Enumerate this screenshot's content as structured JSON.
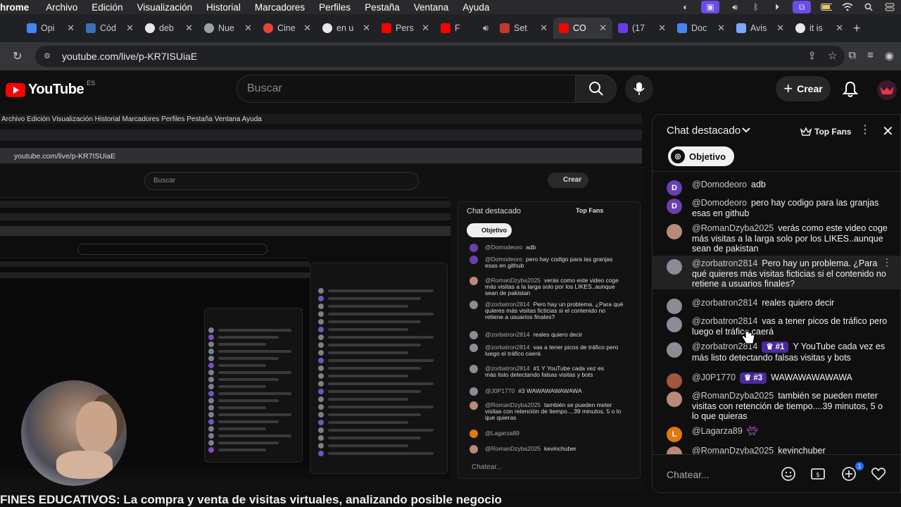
{
  "menubar": {
    "app": "hrome",
    "items": [
      "Archivo",
      "Edición",
      "Visualización",
      "Historial",
      "Marcadores",
      "Perfiles",
      "Pestaña",
      "Ventana",
      "Ayuda"
    ]
  },
  "tabs": [
    {
      "label": "Opi",
      "color": "#4285f4"
    },
    {
      "label": "Cód",
      "color": "#3b6fb6"
    },
    {
      "label": "deb",
      "color": "#e8e8e8"
    },
    {
      "label": "Nue",
      "color": "#9aa0a6"
    },
    {
      "label": "Cine",
      "color": "#ea4335"
    },
    {
      "label": "en u",
      "color": "#e8e8e8"
    },
    {
      "label": "Pers",
      "color": "#ff0000"
    },
    {
      "label": "F",
      "color": "#ff0000"
    },
    {
      "label": "Set",
      "color": "#c0392b"
    },
    {
      "label": "CO",
      "color": "#ff0000",
      "active": true
    },
    {
      "label": "(17",
      "color": "#6a3de8"
    },
    {
      "label": "Doc",
      "color": "#4285f4"
    },
    {
      "label": "Avis",
      "color": "#7aa7ff"
    },
    {
      "label": "it is",
      "color": "#e8e8e8"
    }
  ],
  "omnibox": {
    "url": "youtube.com/live/p-KR7ISUiaE"
  },
  "yt": {
    "logo": "YouTube",
    "country": "ES",
    "search_placeholder": "Buscar",
    "create_label": "Crear"
  },
  "nested": {
    "menu": "Archivo   Edición   Visualización   Historial   Marcadores   Perfiles   Pestaña   Ventana   Ayuda",
    "url": "youtube.com/live/p-KR7ISUiaE",
    "search": "Buscar",
    "create": "Crear",
    "chat_title": "Chat destacado",
    "top_fans": "Top Fans",
    "goal": "Objetivo",
    "chat_placeholder": "Chatear...",
    "lines": [
      {
        "author": "@Domodeoro",
        "text": "adb"
      },
      {
        "author": "@Domodeoro",
        "text": "pero hay codigo para las granjas"
      },
      {
        "author": "",
        "text": "esas en github"
      },
      {
        "author": "@RomanDzyba2025",
        "text": "verás como este video coge"
      },
      {
        "author": "",
        "text": "más visitas a la larga solo por los LIKES..aunque"
      },
      {
        "author": "",
        "text": "sean de pakistan"
      },
      {
        "author": "@zorbatron2814",
        "text": "Pero hay un problema. ¿Para qué"
      },
      {
        "author": "",
        "text": "quieres más visitas ficticias si el contenido no"
      },
      {
        "author": "",
        "text": "retiene a usuarios finales?"
      },
      {
        "author": "@zorbatron2814",
        "text": "reales quiero decir"
      },
      {
        "author": "@zorbatron2814",
        "text": "vas a tener picos de tráfico pero"
      },
      {
        "author": "",
        "text": "luego el tráfico caerá"
      },
      {
        "author": "@zorbatron2814",
        "text": "#1  Y YouTube cada vez es"
      },
      {
        "author": "",
        "text": "más listo detectando falsas visitas y bots"
      },
      {
        "author": "@J0P1770",
        "text": "#3  WAWAWAWAWAWA"
      },
      {
        "author": "@RomanDzyba2025",
        "text": "también se pueden meter"
      },
      {
        "author": "",
        "text": "visitas con retención de tiempo....39 minutos, 5 o lo"
      },
      {
        "author": "",
        "text": "que quieras"
      },
      {
        "author": "@Lagarza89",
        "text": ""
      },
      {
        "author": "@RomanDzyba2025",
        "text": "kevinchuber"
      }
    ]
  },
  "caption": "FINES EDUCATIVOS: La compra y venta de visitas virtuales, analizando posible negocio",
  "chat": {
    "title": "Chat destacado",
    "top_fans": "Top Fans",
    "goal": "Objetivo",
    "input_placeholder": "Chatear...",
    "notif_count": "1",
    "messages": [
      {
        "author": "@Domodeoro",
        "text": "adb",
        "avatar": "D",
        "avatar_color": "#6a3fb0"
      },
      {
        "author": "@Domodeoro",
        "text": "pero hay codigo para las granjas esas en github",
        "avatar": "D",
        "avatar_color": "#6a3fb0"
      },
      {
        "author": "@RomanDzyba2025",
        "text": "verás como este video coge más visitas a la larga solo por los LIKES..aunque sean de pakistan",
        "avatar": "",
        "avatar_color": "#b98a7a"
      },
      {
        "author": "@zorbatron2814",
        "text": "Pero hay un problema. ¿Para qué quieres más visitas ficticias si el contenido no retiene a usuarios finales?",
        "avatar": "",
        "avatar_color": "#8a8c96"
      },
      {
        "author": "@zorbatron2814",
        "text": "reales quiero decir",
        "avatar": "",
        "avatar_color": "#8a8c96"
      },
      {
        "author": "@zorbatron2814",
        "text": "vas a tener picos de tráfico pero luego el tráfico caerá",
        "avatar": "",
        "avatar_color": "#8a8c96"
      },
      {
        "author": "@zorbatron2814",
        "badge": "#1",
        "text": "Y YouTube cada vez es más listo detectando falsas visitas y bots",
        "avatar": "",
        "avatar_color": "#8a8c96"
      },
      {
        "author": "@J0P1770",
        "badge": "#3",
        "text": "WAWAWAWAWAWA",
        "avatar": "",
        "avatar_color": "#a0563f"
      },
      {
        "author": "@RomanDzyba2025",
        "text": "también se pueden meter visitas con retención de tiempo....39 minutos, 5 o lo que quieras",
        "avatar": "",
        "avatar_color": "#b98a7a"
      },
      {
        "author": "@Lagarza89",
        "text": "",
        "avatar": "L",
        "avatar_color": "#e07a10"
      },
      {
        "author": "@RomanDzyba2025",
        "text": "kevinchuber",
        "avatar": "",
        "avatar_color": "#b98a7a"
      }
    ]
  }
}
